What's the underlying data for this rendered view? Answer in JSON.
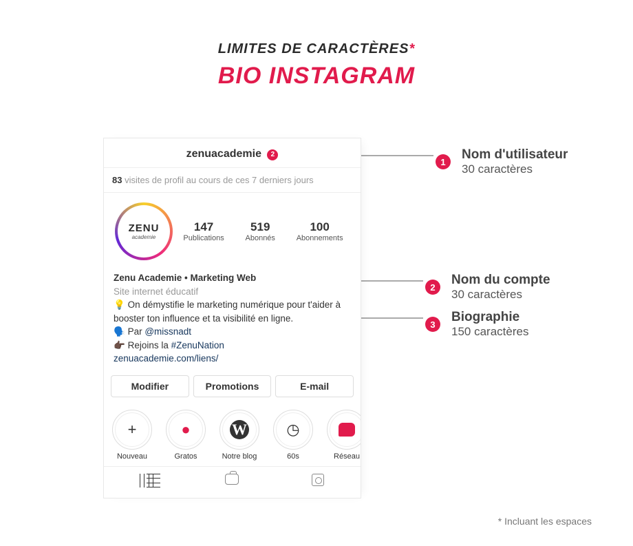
{
  "header": {
    "subtitle": "LIMITES DE CARACTÈRES",
    "asterisk": "*",
    "title": "BIO INSTAGRAM"
  },
  "profile": {
    "username": "zenuacademie",
    "notif_badge": "2",
    "visits_count": "83",
    "visits_text": " visites de profil au cours de ces 7 derniers jours",
    "avatar_text": "ZENU",
    "avatar_sub": "academie",
    "stats": [
      {
        "num": "147",
        "label": "Publications"
      },
      {
        "num": "519",
        "label": "Abonnés"
      },
      {
        "num": "100",
        "label": "Abonnements"
      }
    ],
    "bio": {
      "display_name": "Zenu Academie • Marketing Web",
      "category": "Site internet éducatif",
      "line1_icon": "💡",
      "line1": " On démystifie le marketing numérique pour t'aider à booster ton influence et ta visibilité en ligne.",
      "line2_icon": "🗣️",
      "line2_prefix": " Par ",
      "line2_mention": "@missnadt",
      "line3_icon": "👉🏿",
      "line3_prefix": " Rejoins la ",
      "line3_hashtag": "#ZenuNation",
      "link": "zenuacademie.com/liens/"
    },
    "buttons": {
      "edit": "Modifier",
      "promote": "Promotions",
      "email": "E-mail"
    },
    "stories": [
      {
        "label": "Nouveau",
        "icon": "plus"
      },
      {
        "label": "Gratos",
        "icon": "pin"
      },
      {
        "label": "Notre blog",
        "icon": "wp"
      },
      {
        "label": "60s",
        "icon": "clock"
      },
      {
        "label": "Réseau",
        "icon": "bubble"
      }
    ]
  },
  "callouts": [
    {
      "n": "1",
      "title": "Nom d'utilisateur",
      "detail": "30 caractères"
    },
    {
      "n": "2",
      "title": "Nom du compte",
      "detail": "30 caractères"
    },
    {
      "n": "3",
      "title": "Biographie",
      "detail": "150 caractères"
    }
  ],
  "footnote": "* Incluant les espaces"
}
